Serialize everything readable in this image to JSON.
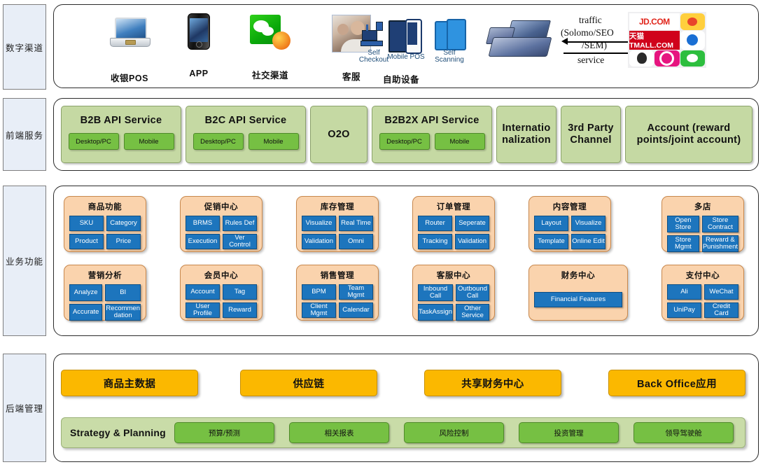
{
  "rail": [
    {
      "label": "数字渠道"
    },
    {
      "label": "前端服务"
    },
    {
      "label": "业务功能"
    },
    {
      "label": "后端管理"
    }
  ],
  "digital_channels": {
    "items": [
      {
        "label": "收银POS",
        "icon": "laptop-pos-icon"
      },
      {
        "label": "APP",
        "icon": "smartphone-icon"
      },
      {
        "label": "社交渠道",
        "icon": "wechat-weibo-icon"
      },
      {
        "label": "客服",
        "icon": "customer-service-photo-icon"
      }
    ],
    "self_service": {
      "label": "自助设备",
      "devices": [
        {
          "label": "Self\nCheckout",
          "line1": "Self",
          "line2": "Checkout",
          "icon": "self-checkout-kiosk-icon"
        },
        {
          "label": "Mobile POS",
          "line1": "Mobile POS",
          "line2": "",
          "icon": "mobile-pos-icon"
        },
        {
          "label": "Self\nScanning",
          "line1": "Self",
          "line2": "Scanning",
          "icon": "self-scanning-icon"
        }
      ]
    },
    "flow": {
      "pos_terminal_icon": "pos-terminal-icon",
      "inbound_label_line1": "traffic",
      "inbound_label_line2": "(Solomo/SEO",
      "inbound_label_line3": "/SEM)",
      "outbound_label": "service",
      "ecommerce_tile": {
        "jd": "JD.COM",
        "weibo": "微博",
        "tmall": "天猫 TMALL.COM",
        "dingding": "钉钉",
        "qq": "QQ",
        "fs": "飞信",
        "wechat": "微信"
      }
    }
  },
  "frontend_services": {
    "boxes": [
      {
        "title": "B2B API Service",
        "subs": [
          "Desktop/PC",
          "Mobile"
        ]
      },
      {
        "title": "B2C API Service",
        "subs": [
          "Desktop/PC",
          "Mobile"
        ]
      },
      {
        "title": "O2O",
        "subs": []
      },
      {
        "title": "B2B2X API Service",
        "subs": [
          "Desktop/PC",
          "Mobile"
        ]
      },
      {
        "title": "Internatio nalization",
        "subs": []
      },
      {
        "title": "3rd Party Channel",
        "subs": []
      },
      {
        "title": "Account (reward points/joint account)",
        "subs": []
      }
    ]
  },
  "business_functions": {
    "row1": [
      {
        "title": "商品功能",
        "cells": [
          "SKU",
          "Category",
          "Product",
          "Price"
        ]
      },
      {
        "title": "促销中心",
        "cells": [
          "BRMS",
          "Rules Def",
          "Execution",
          "Ver Control"
        ]
      },
      {
        "title": "库存管理",
        "cells": [
          "Visualize",
          "Real Time",
          "Validation",
          "Omni"
        ]
      },
      {
        "title": "订单管理",
        "cells": [
          "Router",
          "Seperate",
          "Tracking",
          "Validation"
        ]
      },
      {
        "title": "内容管理",
        "cells": [
          "Layout",
          "Visualize",
          "Template",
          "Online Edit"
        ]
      },
      {
        "title": "多店",
        "cells": [
          "Open Store",
          "Store Contract",
          "Store Mgmt",
          "Reward & Punishment"
        ]
      }
    ],
    "row2": [
      {
        "title": "营销分析",
        "cells": [
          "Analyze",
          "BI",
          "Accurate",
          "Recommen dation"
        ]
      },
      {
        "title": "会员中心",
        "cells": [
          "Account",
          "Tag",
          "User Profile",
          "Reward"
        ]
      },
      {
        "title": "销售管理",
        "cells": [
          "BPM",
          "Team Mgmt",
          "Client Mgmt",
          "Calendar"
        ]
      },
      {
        "title": "客服中心",
        "cells": [
          "Inbound Call",
          "Outbound Call",
          "TaskAssign",
          "Other Service"
        ]
      },
      {
        "title": "财务中心",
        "cells": [
          "Financial Features"
        ],
        "single": true
      },
      {
        "title": "支付中心",
        "cells": [
          "Ali",
          "WeChat",
          "UniPay",
          "Credit Card"
        ]
      }
    ]
  },
  "back_office": {
    "gold_boxes": [
      "商品主数据",
      "供应链",
      "共享财务中心",
      "Back Office应用"
    ],
    "strategy": {
      "title": "Strategy & Planning",
      "chips": [
        "预算/预测",
        "相关报表",
        "风险控制",
        "投资管理",
        "领导驾驶舱"
      ]
    }
  },
  "colors": {
    "rail_bg": "#e8eef7",
    "service_green": "#c5d9a3",
    "service_sub_green": "#76c043",
    "module_peach": "#fad3ad",
    "module_cell_blue": "#1d75bd",
    "gold": "#fbb800",
    "strip_green": "#c9dca8"
  }
}
